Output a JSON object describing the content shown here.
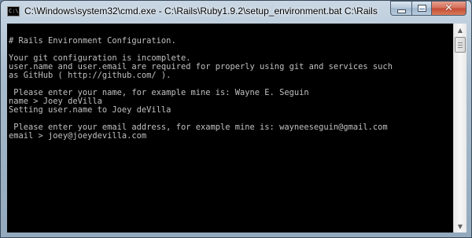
{
  "window": {
    "title": "C:\\Windows\\system32\\cmd.exe - C:\\Rails\\Ruby1.9.2\\setup_environment.bat  C:\\Rails",
    "app_icon_text": "C:\\"
  },
  "titlebar_buttons": {
    "minimize": "minimize",
    "maximize": "maximize",
    "close": "✕"
  },
  "console": {
    "lines": [
      "",
      "# Rails Environment Configuration.",
      "",
      "Your git configuration is incomplete.",
      "user.name and user.email are required for properly using git and services such",
      "as GitHub ( http://github.com/ ).",
      "",
      " Please enter your name, for example mine is: Wayne E. Seguin",
      "name > Joey deVilla",
      "Setting user.name to Joey deVilla",
      "",
      " Please enter your email address, for example mine is: wayneeseguin@gmail.com",
      "email > joey@joeydevilla.com"
    ]
  },
  "scrollbar": {
    "up_arrow": "▲",
    "down_arrow": "▼"
  }
}
